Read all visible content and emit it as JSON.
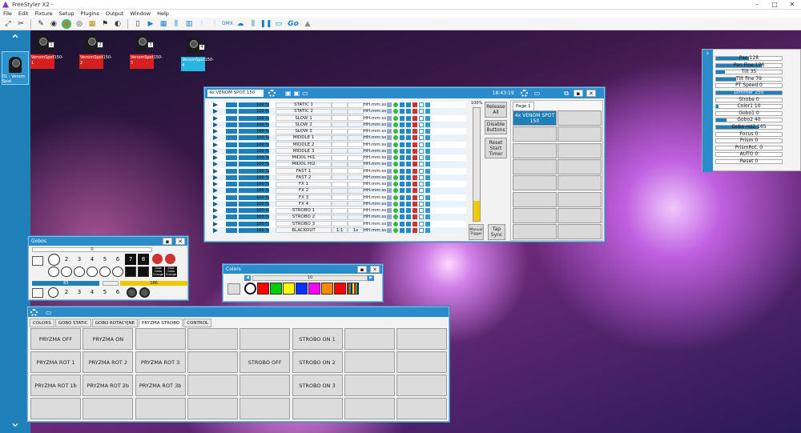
{
  "app": {
    "title": "FreeStyler X2 -"
  },
  "menu": [
    "File",
    "Edit",
    "Fixture",
    "Setup",
    "Plugins",
    "Output",
    "Window",
    "Help"
  ],
  "toolbar": {
    "go_label": "Go"
  },
  "sidebar": {
    "fixture_label": "01 - Venom Spot"
  },
  "fixtures": [
    {
      "num": "1",
      "label": "VenomSpot150-1",
      "color": "#d62020"
    },
    {
      "num": "2",
      "label": "VenomSpot150-2",
      "color": "#d62020"
    },
    {
      "num": "3",
      "label": "VenomSpot150-3",
      "color": "#d62020"
    },
    {
      "num": "4",
      "label": "VenomSpot150-4",
      "color": "#28b4e0"
    }
  ],
  "scene_window": {
    "fixture_select": "4x VENOM SPOT 150",
    "clock": "18:43:19",
    "master_pct": "100%",
    "page_tab": "Page 1",
    "page_button": "4x VENOM SPOT 150",
    "side_buttons": [
      "Release All",
      "Disable Buttons",
      "Reset Start Timer"
    ],
    "manual_trigger": "Manual Trigger",
    "tap_sync": "Tap Sync",
    "rows": [
      {
        "pct": "100 %",
        "name": "STATIC 1",
        "time": "HH:mm:ss",
        "level": 1
      },
      {
        "pct": "100 %",
        "name": "STATIC 2",
        "time": "HH:mm:ss",
        "level": 1
      },
      {
        "pct": "100 %",
        "name": "SLOW 1",
        "time": "HH:mm:ss",
        "level": 1
      },
      {
        "pct": "100 %",
        "name": "SLOW 2",
        "time": "HH:mm:ss",
        "level": 1
      },
      {
        "pct": "100 %",
        "name": "SLOW 3",
        "time": "HH:mm:ss",
        "level": 1
      },
      {
        "pct": "100 %",
        "name": "MIDDLE 1",
        "time": "HH:mm:ss",
        "level": 1
      },
      {
        "pct": "100 %",
        "name": "MIDDLE 2",
        "time": "HH:mm:ss",
        "level": 1
      },
      {
        "pct": "100 %",
        "name": "MIDDLE 3",
        "time": "HH:mm:ss",
        "level": 1
      },
      {
        "pct": "100 %",
        "name": "MIDDL HI1",
        "time": "HH:mm:ss",
        "level": 1
      },
      {
        "pct": "100 %",
        "name": "MIDDL HI2",
        "time": "HH:mm:ss",
        "level": 1
      },
      {
        "pct": "100 %",
        "name": "FAST 1",
        "time": "HH:mm:ss",
        "level": 1
      },
      {
        "pct": "100 %",
        "name": "FAST 2",
        "time": "HH:mm:ss",
        "level": 1
      },
      {
        "pct": "100 %",
        "name": "FX 1",
        "time": "HH:mm:ss",
        "level": 1
      },
      {
        "pct": "100 %",
        "name": "FX 2",
        "time": "HH:mm:ss",
        "level": 1
      },
      {
        "pct": "100 %",
        "name": "FX 3",
        "time": "HH:mm:ss",
        "level": 1
      },
      {
        "pct": "100 %",
        "name": "FX 4",
        "time": "HH:mm:ss",
        "level": 1
      },
      {
        "pct": "100 %",
        "name": "STROBO 1",
        "time": "HH:mm:ss",
        "level": 1
      },
      {
        "pct": "100 %",
        "name": "STROBO 2",
        "time": "HH:mm:ss",
        "level": 1
      },
      {
        "pct": "100 %",
        "name": "STROBO 3",
        "time": "HH:mm:ss",
        "level": 1
      },
      {
        "pct": "100 %",
        "name": "BLACKOUT",
        "time": "HH:mm:ss",
        "level": 1,
        "a": "1:1",
        "b": "1s"
      }
    ]
  },
  "gobos_window": {
    "title": "Gobos",
    "top_value": "0",
    "row1": [
      "1",
      "2",
      "3",
      "4",
      "5",
      "6",
      "7",
      "8"
    ],
    "row1_extra": [
      "Slow Gobo Change",
      "Slow Gobo Change"
    ],
    "mid_value1": "43",
    "mid_value2": "186",
    "row2": [
      "1",
      "2",
      "3",
      "4",
      "5",
      "6"
    ]
  },
  "colors_window": {
    "title": "Colors",
    "value": "10",
    "swatches": [
      "#ff0000",
      "#00cc00",
      "#ffff00",
      "#0033ff",
      "#ff00ff",
      "#ff8800",
      "#ff0000"
    ]
  },
  "preset_window": {
    "tabs": [
      "COLORS",
      "GOBO STATIC",
      "GOBO ROTACYJNE",
      "PRYZMA STROBO",
      "CONTROL"
    ],
    "active_tab": 3,
    "buttons": [
      [
        "PRYZMA OFF",
        "PRYZMA ON",
        "",
        "",
        "",
        "STROBO ON 1",
        "",
        ""
      ],
      [
        "PRYZMA ROT 1",
        "PRYZMA ROT 2",
        "PRYZMA ROT 3",
        "",
        "STROBO OFF",
        "STROBO ON 2",
        "",
        ""
      ],
      [
        "PRYZMA ROT 1b",
        "PRYZMA ROT 2b",
        "PRYZMA ROT 3b",
        "",
        "",
        "STROBO ON 3",
        "",
        ""
      ],
      [
        "",
        "",
        "",
        "",
        "",
        "",
        "",
        ""
      ]
    ]
  },
  "properties": {
    "items": [
      {
        "label": "Pan",
        "value": "128",
        "level": 0.5
      },
      {
        "label": "Pan Fine",
        "value": "176",
        "level": 0.69
      },
      {
        "label": "Tilt",
        "value": "35",
        "level": 0.14
      },
      {
        "label": "Tilt fine",
        "value": "79",
        "level": 0.31
      },
      {
        "label": "PT Speed",
        "value": "0",
        "level": 0
      },
      {
        "label": "Dimmer",
        "value": "255",
        "level": 1
      },
      {
        "label": "Strobe",
        "value": "0",
        "level": 0
      },
      {
        "label": "Color1",
        "value": "10",
        "level": 0.04
      },
      {
        "label": "Gobo1",
        "value": "0",
        "level": 0
      },
      {
        "label": "Gobo2",
        "value": "40",
        "level": 0.16
      },
      {
        "label": "Gobo rot2",
        "value": "165",
        "level": 0.65
      },
      {
        "label": "Focus",
        "value": "0",
        "level": 0
      },
      {
        "label": "Prism",
        "value": "0",
        "level": 0
      },
      {
        "label": "PrismRot.",
        "value": "0",
        "level": 0
      },
      {
        "label": "AUTO",
        "value": "0",
        "level": 0
      },
      {
        "label": "Reset",
        "value": "0",
        "level": 0
      }
    ]
  }
}
